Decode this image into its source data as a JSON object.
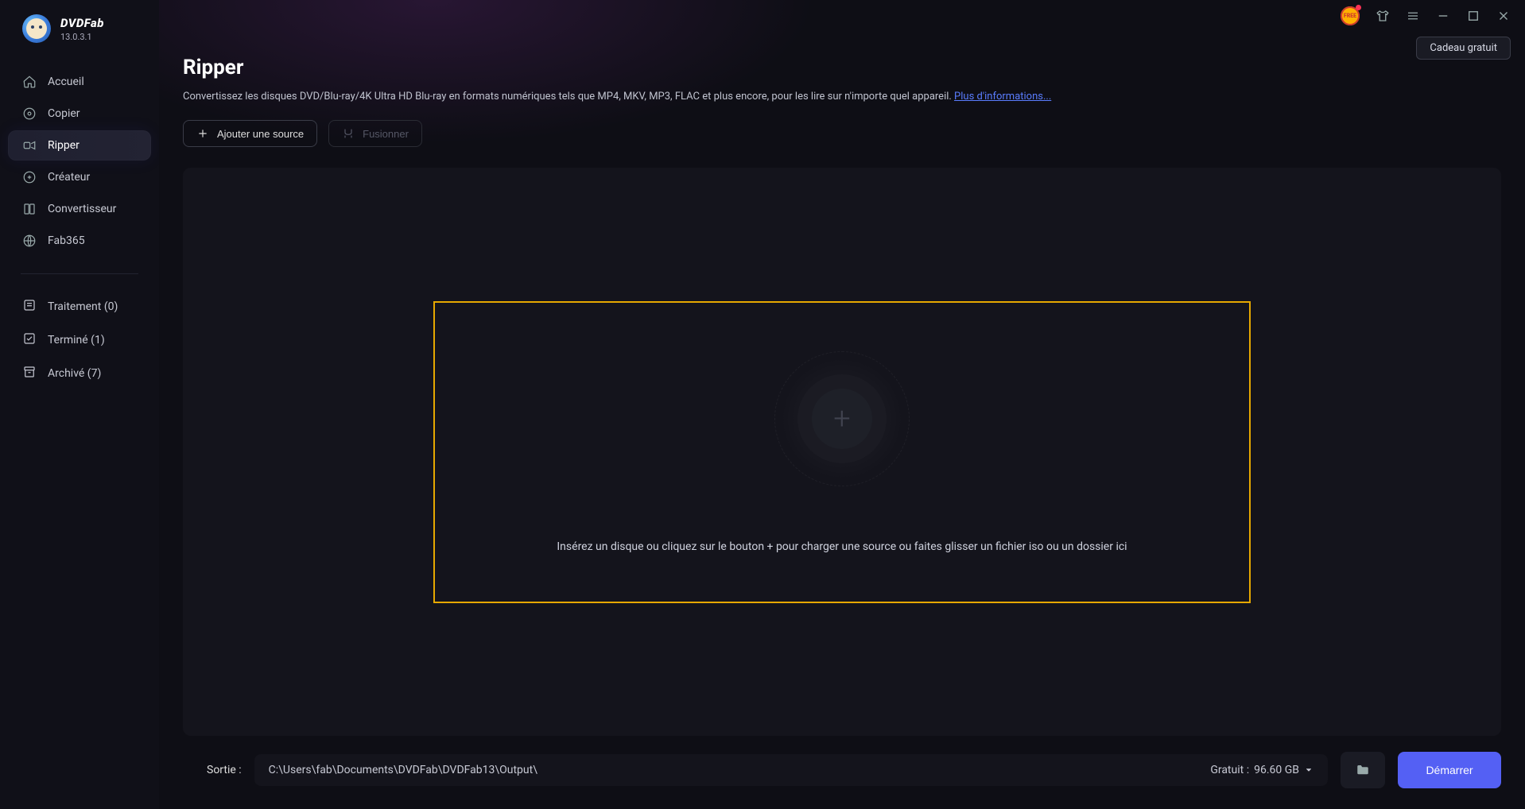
{
  "app": {
    "brand": "DVDFab",
    "version": "13.0.3.1",
    "free_badge": "FREE"
  },
  "titlebar": {
    "gift_label": "Cadeau gratuit"
  },
  "sidebar": {
    "items": [
      {
        "label": "Accueil"
      },
      {
        "label": "Copier"
      },
      {
        "label": "Ripper"
      },
      {
        "label": "Créateur"
      },
      {
        "label": "Convertisseur"
      },
      {
        "label": "Fab365"
      }
    ],
    "queue": [
      {
        "label": "Traitement (0)"
      },
      {
        "label": "Terminé (1)"
      },
      {
        "label": "Archivé (7)"
      }
    ]
  },
  "page": {
    "title": "Ripper",
    "description": "Convertissez les disques DVD/Blu-ray/4K Ultra HD Blu-ray en formats numériques tels que MP4, MKV, MP3, FLAC et plus encore, pour les lire sur n'importe quel appareil. ",
    "more_info": "Plus d'informations...",
    "add_source": "Ajouter une source",
    "merge": "Fusionner",
    "drop_hint": "Insérez un disque ou cliquez sur le bouton +  pour charger une source ou faites glisser un fichier iso ou un dossier ici"
  },
  "footer": {
    "output_label": "Sortie :",
    "output_path": "C:\\Users\\fab\\Documents\\DVDFab\\DVDFab13\\Output\\",
    "free_space_label": "Gratuit :",
    "free_space_value": "96.60 GB",
    "start": "Démarrer"
  }
}
